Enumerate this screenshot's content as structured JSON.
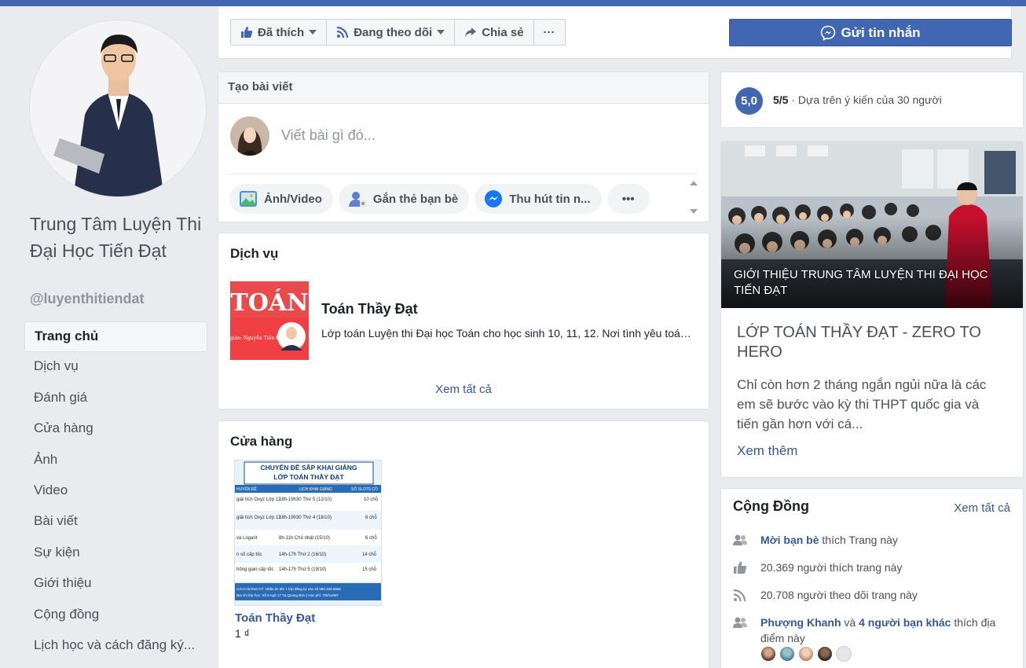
{
  "page": {
    "name": "Trung Tâm Luyện Thi Đại Học Tiến Đạt",
    "handle": "@luyenthitiendat"
  },
  "nav": [
    {
      "label": "Trang chủ",
      "active": true
    },
    {
      "label": "Dịch vụ"
    },
    {
      "label": "Đánh giá"
    },
    {
      "label": "Cửa hàng"
    },
    {
      "label": "Ảnh"
    },
    {
      "label": "Video"
    },
    {
      "label": "Bài viết"
    },
    {
      "label": "Sự kiện"
    },
    {
      "label": "Giới thiệu"
    },
    {
      "label": "Cộng đồng"
    },
    {
      "label": "Lịch học và cách đăng ký..."
    }
  ],
  "actions": {
    "liked": "Đã thích",
    "following": "Đang theo dõi",
    "share": "Chia sẻ",
    "more": "···",
    "send_message": "Gửi tin nhắn"
  },
  "compose": {
    "title": "Tạo bài viết",
    "placeholder": "Viết bài gì đó...",
    "chips": [
      "Ảnh/Video",
      "Gắn thẻ bạn bè",
      "Thu hút tin n..."
    ],
    "more": "•••"
  },
  "services": {
    "title": "Dịch vụ",
    "image_text": "TOÁN",
    "image_sub": "Thầy giáo: Nguyễn Tiến Đạt",
    "item_title": "Toán Thầy Đạt",
    "item_desc": "Lớp toán Luyện thi Đại học Toán cho học sinh 10, 11, 12. Nơi tình yêu toán học được khơi dậy",
    "see_all": "Xem tất cả"
  },
  "shop": {
    "title": "Cửa hàng",
    "poster_line1": "CHUYÊN ĐỀ SẮP KHAI GIẢNG",
    "poster_line2": "LỚP TOÁN THẦY ĐẠT",
    "poster_headers": [
      "HUYÊN ĐỀ",
      "LỊCH KHAI GIẢNG",
      "SỐ SLOTS CÒ"
    ],
    "poster_rows": [
      [
        "giải tích Oxyz Lớp 12",
        "18h-19h30 Thứ 5 (12/10)",
        "10 chỗ"
      ],
      [
        "giải tích Oxyz Lớp 12",
        "18h-19h30 Thứ 4 (18/10)",
        "6 chỗ"
      ],
      [
        "và Logarit",
        "8h-11h Chủ nhật (15/10)",
        "6 chỗ"
      ],
      [
        "n số cấp tốc",
        "14h-17h Thứ 2 (16/10)",
        "14 chỗ"
      ],
      [
        "hông gian cấp tốc",
        "14h-17h Thứ 5 (19/10)",
        "15 chỗ"
      ]
    ],
    "poster_footer1": "CÁCH ĐĂNG KÝ: Nhắn tin tên + lớp đăng ký vào số 090.328.8866",
    "poster_footer2": "Địa chỉ lớp học: Số 8 ngõ 17 Tạ Quang Bửu | Học phí: 70k/ca/90'",
    "item_name": "Toán Thầy Đạt",
    "item_price": "1 ₫"
  },
  "rating": {
    "score": "5,0",
    "label": "5/5",
    "text": "· Dựa trên ý kiến của 30 người"
  },
  "featured": {
    "caption": "GIỚI THIỆU TRUNG TÂM LUYỆN THI ĐẠI HỌC TIẾN ĐẠT",
    "title": "LỚP TOÁN THẦY ĐẠT - ZERO TO HERO",
    "body": "Chỉ còn hơn 2 tháng ngắn ngủi nữa là các em sẽ bước vào kỳ thi THPT quốc gia và tiến gần hơn với cá...",
    "more": "Xem thêm"
  },
  "community": {
    "title": "Cộng Đồng",
    "see_all": "Xem tất cả",
    "invite_link": "Mời bạn bè",
    "invite_text": " thích Trang này",
    "likes": "20.369 người thích trang này",
    "follows": "20.708 người theo dõi trang này",
    "friend_name": "Phượng Khanh",
    "and": " và ",
    "friends_more": "4 người bạn khác",
    "friends_text": " thích địa điểm này"
  }
}
